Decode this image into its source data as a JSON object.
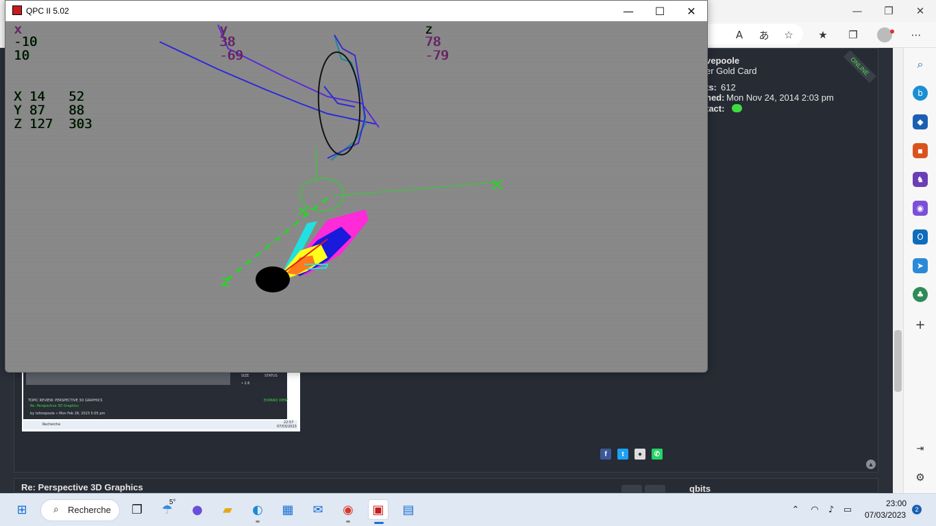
{
  "qpc_window": {
    "title": "QPC II 5.02",
    "minimize": "—",
    "maximize": "☐",
    "close": "✕"
  },
  "qpc_readout": {
    "x_header": "x",
    "x_line1": "-10",
    "x_line2": "10",
    "y_header": "y",
    "y_line1": "38",
    "y_line2": "-69",
    "z_header": "z",
    "z_line1": "78",
    "z_line2": "-79",
    "row_x": "X 14   52",
    "row_y": "Y 87   88",
    "row_z": "Z 127  303"
  },
  "edge": {
    "window_min": "—",
    "window_max": "❐",
    "window_close": "✕",
    "toolbar_icons": [
      "read-aloud-icon",
      "translate-icon",
      "add-favorite-icon",
      "favorites-icon",
      "collections-icon",
      "profile-icon",
      "more-icon"
    ]
  },
  "forum_post": {
    "username": "vepoole",
    "rank": "er Gold Card",
    "posts_label": "ts:",
    "posts_value": "612",
    "joined_label": "ned:",
    "joined_value": "Mon Nov 24, 2014 2:03 pm",
    "contact_label": "tact:",
    "online_badge": "ONLINE"
  },
  "next_post": {
    "title": "Re: Perspective 3D Graphics",
    "author": "qbits"
  },
  "thumbnail": {
    "size_label": "SIZE",
    "status_label": "STATUS",
    "size_value": "• 2.6",
    "topic_review": "TOPIC REVIEW: PERSPECTIVE 3D GRAPHICS",
    "expand_view": "EXPAND VIEW",
    "post_title": "Re: Perspective 3D Graphics",
    "post_by": "by tofsrepoole » Mon Feb 28, 2023 5:05 pm",
    "search": "Recherche",
    "time": "22:57",
    "date": "07/03/2023"
  },
  "taskbar": {
    "search_label": "Recherche",
    "weather_temp": "5°",
    "time": "23:00",
    "date": "07/03/2023",
    "notification_count": "2"
  },
  "colors": {
    "forum_bg": "#262b34",
    "forum_green": "#3fdc3f",
    "qpc_canvas": "#868686"
  }
}
